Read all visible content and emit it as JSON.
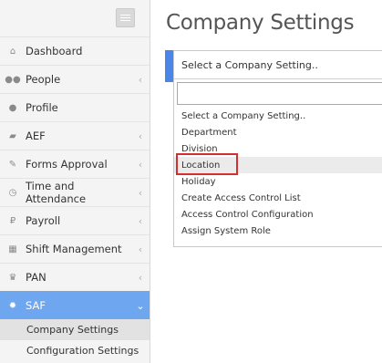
{
  "sidebar": {
    "items": [
      {
        "label": "Dashboard",
        "icon": "home-icon",
        "glyph": "⌂",
        "has_chevron": false
      },
      {
        "label": "People",
        "icon": "users-icon",
        "glyph": "●●",
        "has_chevron": true
      },
      {
        "label": "Profile",
        "icon": "user-icon",
        "glyph": "●",
        "has_chevron": false
      },
      {
        "label": "AEF",
        "icon": "folder-icon",
        "glyph": "▰",
        "has_chevron": true
      },
      {
        "label": "Forms Approval",
        "icon": "pencil-icon",
        "glyph": "✎",
        "has_chevron": true
      },
      {
        "label": "Time and Attendance",
        "icon": "clock-icon",
        "glyph": "◷",
        "has_chevron": true
      },
      {
        "label": "Payroll",
        "icon": "ruble-icon",
        "glyph": "₽",
        "has_chevron": true
      },
      {
        "label": "Shift Management",
        "icon": "calendar-icon",
        "glyph": "▦",
        "has_chevron": true
      },
      {
        "label": "PAN",
        "icon": "trophy-icon",
        "glyph": "♛",
        "has_chevron": true
      },
      {
        "label": "SAF",
        "icon": "gear-icon",
        "glyph": "✹",
        "has_chevron": true,
        "active": true
      }
    ],
    "sub_items": [
      {
        "label": "Company Settings",
        "selected": true
      },
      {
        "label": "Configuration Settings",
        "selected": false
      }
    ],
    "chevron_glyph": "‹",
    "chevron_open_glyph": "⌄"
  },
  "main": {
    "title": "Company Settings",
    "select": {
      "selected_label": "Select a Company Setting..",
      "search_value": "",
      "options": [
        "Select a Company Setting..",
        "Department",
        "Division",
        "Location",
        "Holiday",
        "Create Access Control List",
        "Access Control Configuration",
        "Assign System Role"
      ],
      "hovered_option": "Location"
    }
  },
  "colors": {
    "accent": "#4a86e8",
    "active_nav": "#6ea7f0",
    "highlight": "#d32f2f"
  }
}
